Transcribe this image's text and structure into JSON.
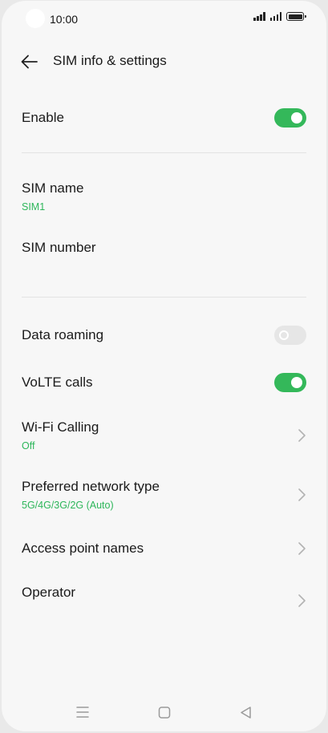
{
  "status_bar": {
    "time": "10:00"
  },
  "header": {
    "title": "SIM info & settings"
  },
  "rows": {
    "enable": {
      "label": "Enable",
      "toggle": "on"
    },
    "sim_name": {
      "label": "SIM name",
      "value": "SIM1"
    },
    "sim_number": {
      "label": "SIM number"
    },
    "data_roaming": {
      "label": "Data roaming",
      "toggle": "off"
    },
    "volte_calls": {
      "label": "VoLTE calls",
      "toggle": "on"
    },
    "wifi_calling": {
      "label": "Wi-Fi Calling",
      "value": "Off"
    },
    "preferred_network": {
      "label": "Preferred network type",
      "value": "5G/4G/3G/2G (Auto)"
    },
    "apn": {
      "label": "Access point names"
    },
    "operator": {
      "label": "Operator"
    }
  },
  "colors": {
    "accent": "#34b85a",
    "subtext": "#2db65a",
    "background": "#f7f7f7"
  },
  "icons": {
    "back": "arrow-left-icon",
    "chevron": "chevron-right-icon",
    "nav_menu": "menu-icon",
    "nav_home": "square-home-icon",
    "nav_back": "triangle-back-icon"
  }
}
